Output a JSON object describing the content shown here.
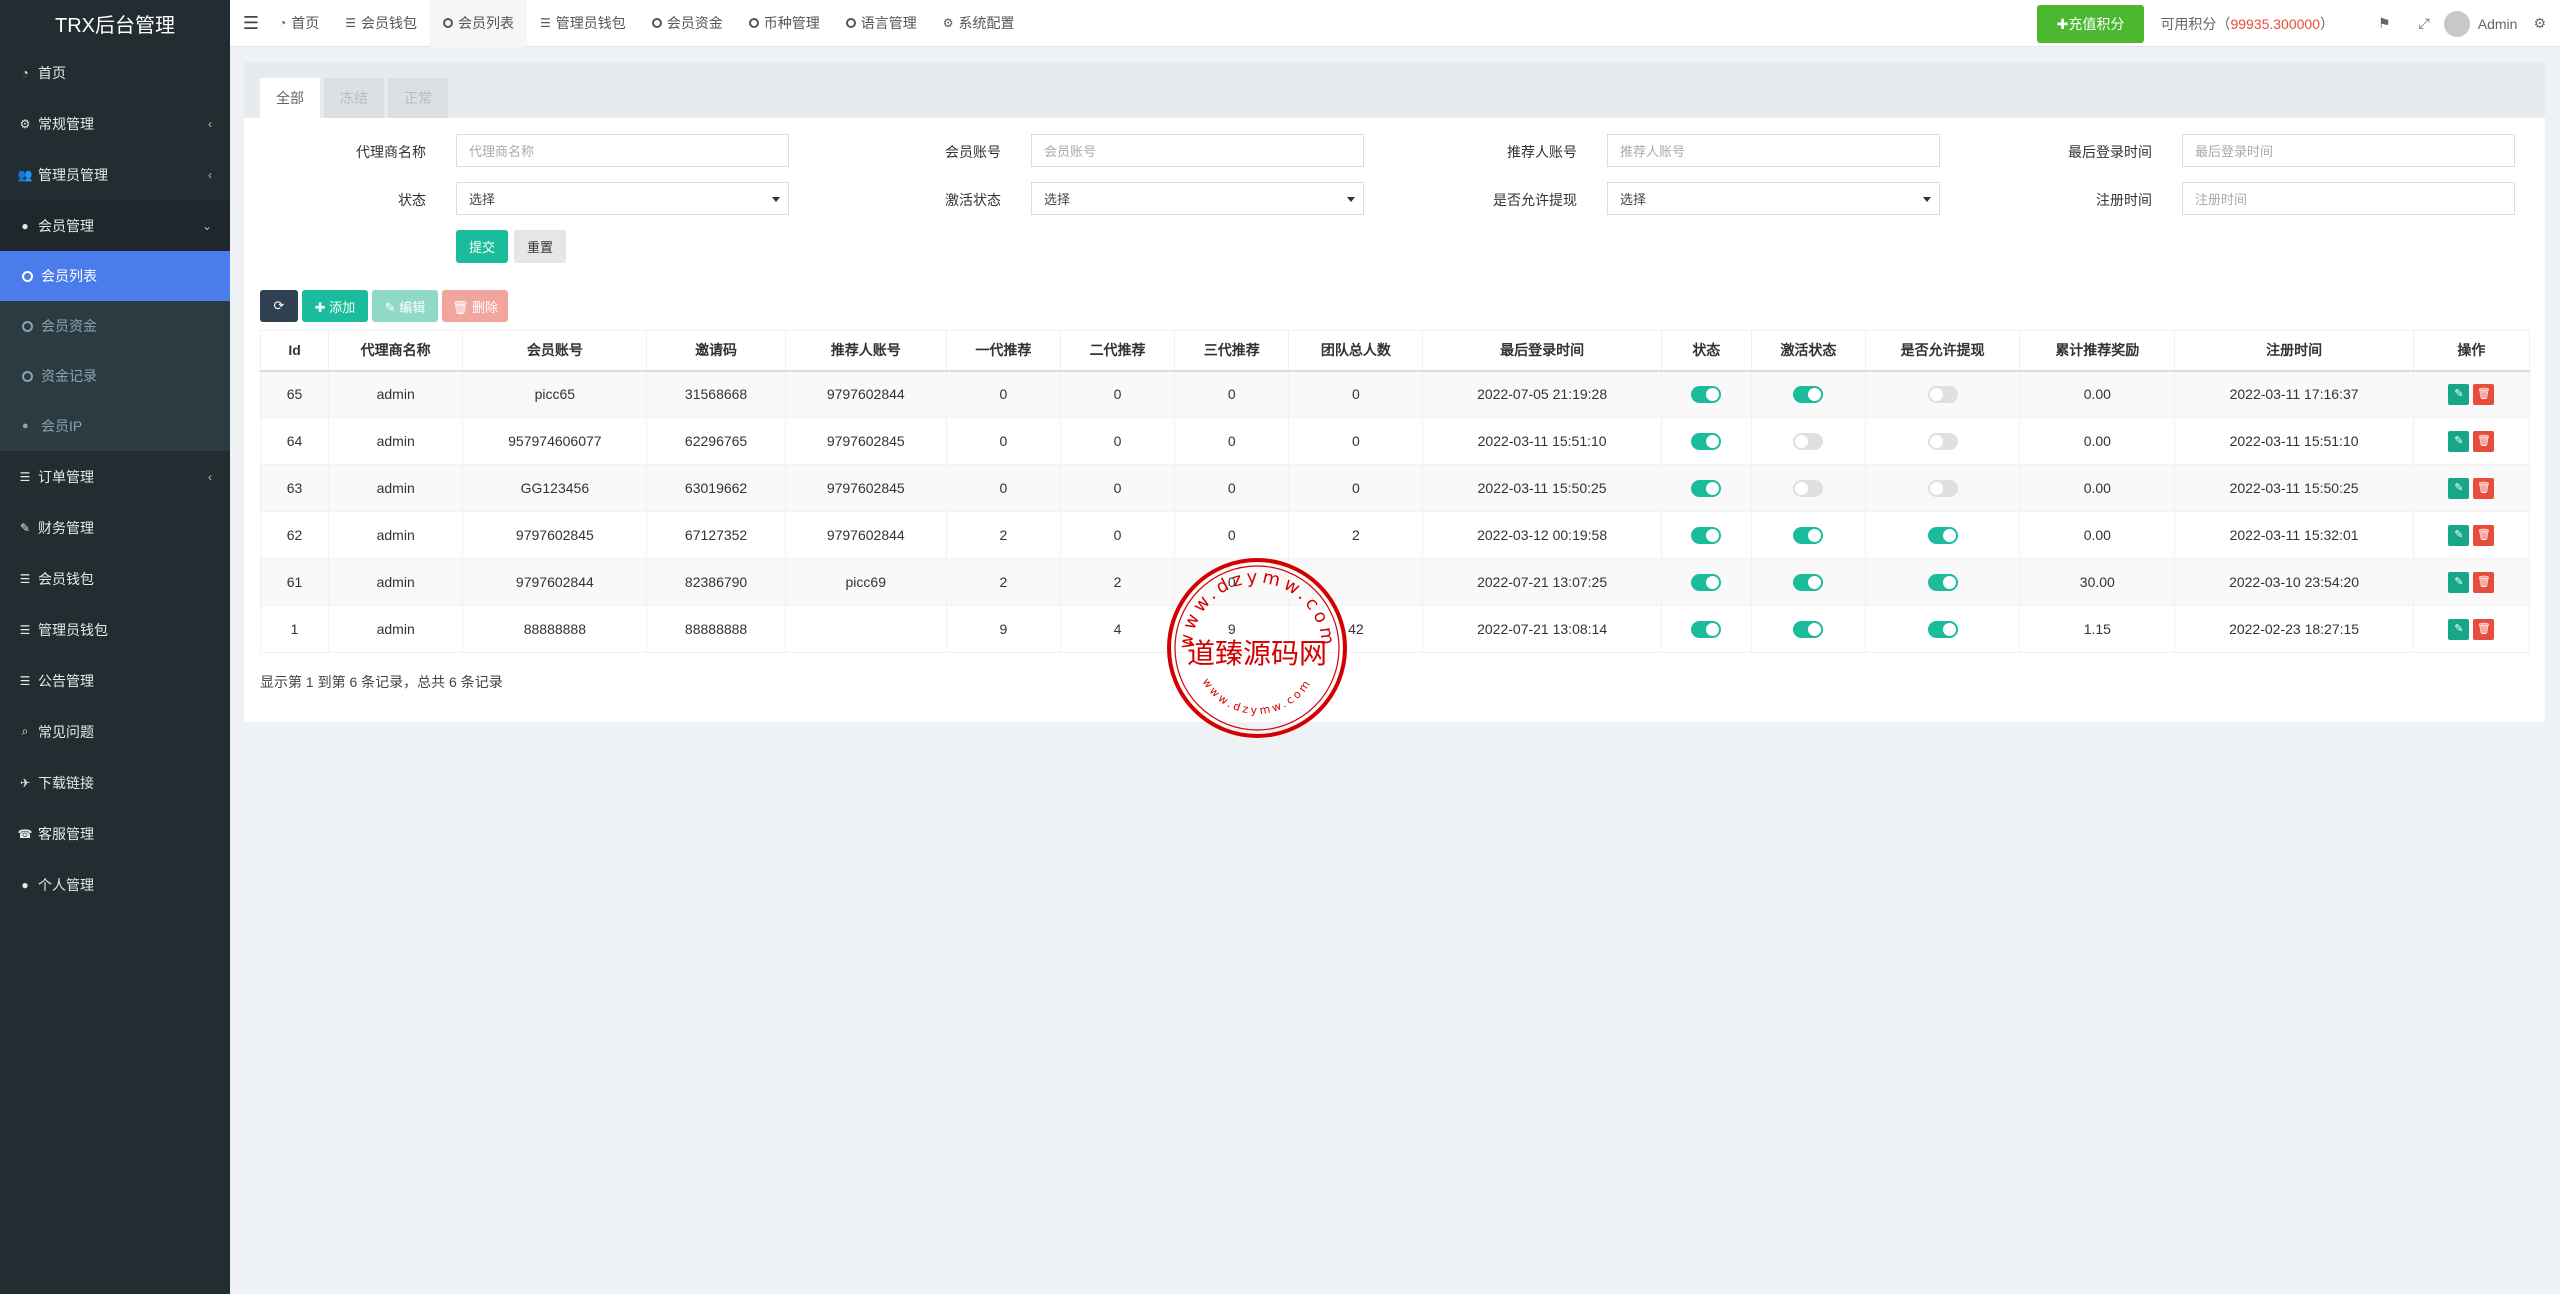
{
  "brand": "TRX后台管理",
  "sidebar": {
    "items": [
      {
        "label": "首页",
        "icon": "dashboard-icon"
      },
      {
        "label": "常规管理",
        "icon": "cogs-icon"
      },
      {
        "label": "管理员管理",
        "icon": "users-icon"
      },
      {
        "label": "会员管理",
        "icon": "user-icon"
      },
      {
        "label": "订单管理",
        "icon": "list-icon"
      },
      {
        "label": "财务管理",
        "icon": "edit-icon"
      },
      {
        "label": "会员钱包",
        "icon": "list-icon"
      },
      {
        "label": "管理员钱包",
        "icon": "list-icon"
      },
      {
        "label": "公告管理",
        "icon": "list-icon"
      },
      {
        "label": "常见问题",
        "icon": "search-icon"
      },
      {
        "label": "下载链接",
        "icon": "plane-icon"
      },
      {
        "label": "客服管理",
        "icon": "phone-icon"
      },
      {
        "label": "个人管理",
        "icon": "user-icon"
      }
    ],
    "sub_items": [
      "会员列表",
      "会员资金",
      "资金记录",
      "会员IP"
    ]
  },
  "topnav": {
    "items": [
      "首页",
      "会员钱包",
      "会员列表",
      "管理员钱包",
      "会员资金",
      "币种管理",
      "语言管理",
      "系统配置"
    ],
    "recharge": "✚充值积分",
    "balance_label": "可用积分（",
    "balance_value": "99935.300000",
    "balance_close": "）",
    "admin": "Admin"
  },
  "tabs": [
    "全部",
    "冻结",
    "正常"
  ],
  "filters": {
    "agent_label": "代理商名称",
    "agent_placeholder": "代理商名称",
    "account_label": "会员账号",
    "account_placeholder": "会员账号",
    "referrer_label": "推荐人账号",
    "referrer_placeholder": "推荐人账号",
    "lastlogin_label": "最后登录时间",
    "lastlogin_placeholder": "最后登录时间",
    "status_label": "状态",
    "status_value": "选择",
    "activation_label": "激活状态",
    "activation_value": "选择",
    "withdraw_label": "是否允许提现",
    "withdraw_value": "选择",
    "regtime_label": "注册时间",
    "regtime_placeholder": "注册时间",
    "submit": "提交",
    "reset": "重置"
  },
  "toolbar": {
    "add": "✚ 添加",
    "edit": "✎ 编辑",
    "delete": "🗑 删除"
  },
  "table": {
    "headers": [
      "Id",
      "代理商名称",
      "会员账号",
      "邀请码",
      "推荐人账号",
      "一代推荐",
      "二代推荐",
      "三代推荐",
      "团队总人数",
      "最后登录时间",
      "状态",
      "激活状态",
      "是否允许提现",
      "累计推荐奖励",
      "注册时间",
      "操作"
    ],
    "rows": [
      {
        "id": "65",
        "agent": "admin",
        "account": "picc65",
        "invite": "31568668",
        "referrer": "9797602844",
        "g1": "0",
        "g2": "0",
        "g3": "0",
        "team": "0",
        "last": "2022-07-05 21:19:28",
        "status": true,
        "active": true,
        "withdraw": false,
        "reward": "0.00",
        "reg": "2022-03-11 17:16:37"
      },
      {
        "id": "64",
        "agent": "admin",
        "account": "957974606077",
        "invite": "62296765",
        "referrer": "9797602845",
        "g1": "0",
        "g2": "0",
        "g3": "0",
        "team": "0",
        "last": "2022-03-11 15:51:10",
        "status": true,
        "active": false,
        "withdraw": false,
        "reward": "0.00",
        "reg": "2022-03-11 15:51:10"
      },
      {
        "id": "63",
        "agent": "admin",
        "account": "GG123456",
        "invite": "63019662",
        "referrer": "9797602845",
        "g1": "0",
        "g2": "0",
        "g3": "0",
        "team": "0",
        "last": "2022-03-11 15:50:25",
        "status": true,
        "active": false,
        "withdraw": false,
        "reward": "0.00",
        "reg": "2022-03-11 15:50:25"
      },
      {
        "id": "62",
        "agent": "admin",
        "account": "9797602845",
        "invite": "67127352",
        "referrer": "9797602844",
        "g1": "2",
        "g2": "0",
        "g3": "0",
        "team": "2",
        "last": "2022-03-12 00:19:58",
        "status": true,
        "active": true,
        "withdraw": true,
        "reward": "0.00",
        "reg": "2022-03-11 15:32:01"
      },
      {
        "id": "61",
        "agent": "admin",
        "account": "9797602844",
        "invite": "82386790",
        "referrer": "picc69",
        "g1": "2",
        "g2": "2",
        "g3": "0",
        "team": "",
        "last": "2022-07-21 13:07:25",
        "status": true,
        "active": true,
        "withdraw": true,
        "reward": "30.00",
        "reg": "2022-03-10 23:54:20"
      },
      {
        "id": "1",
        "agent": "admin",
        "account": "88888888",
        "invite": "88888888",
        "referrer": "",
        "g1": "9",
        "g2": "4",
        "g3": "9",
        "team": "42",
        "last": "2022-07-21 13:08:14",
        "status": true,
        "active": true,
        "withdraw": true,
        "reward": "1.15",
        "reg": "2022-02-23 18:27:15"
      }
    ]
  },
  "pager": "显示第 1 到第 6 条记录，总共 6 条记录",
  "stamp": {
    "text": "道臻源码网",
    "url": "www.dzymw.com"
  },
  "colors": {
    "sidebar": "#222d32",
    "active": "#4b7ceb",
    "teal": "#1abc9c",
    "green": "#4cb830",
    "red": "#e74c3c"
  }
}
